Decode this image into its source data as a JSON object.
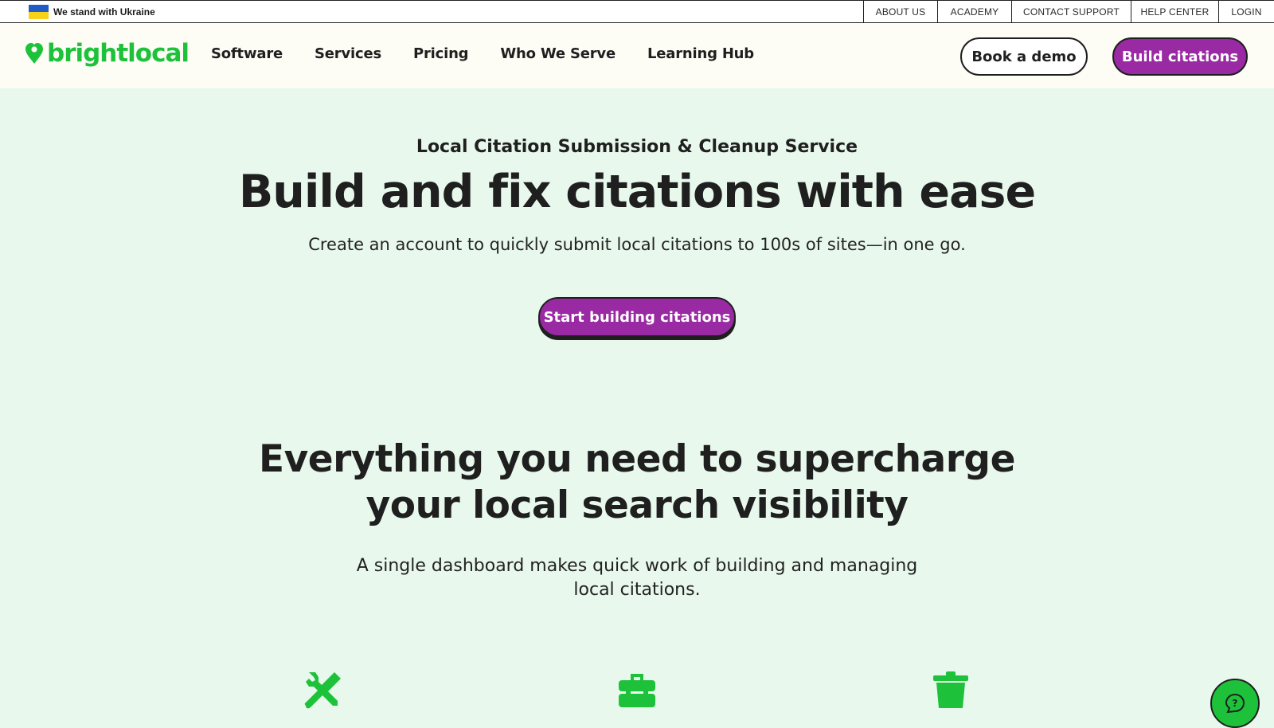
{
  "topbar": {
    "ukraine_text": "We stand with Ukraine",
    "links": [
      "ABOUT US",
      "ACADEMY",
      "CONTACT SUPPORT",
      "HELP CENTER",
      "LOGIN"
    ],
    "flag_colors": {
      "top": "#1f5cc4",
      "bottom": "#f6d21b"
    }
  },
  "header": {
    "logo_text": "brightlocal",
    "nav": [
      "Software",
      "Services",
      "Pricing",
      "Who We Serve",
      "Learning Hub"
    ],
    "demo_label": "Book a demo",
    "build_label": "Build citations"
  },
  "hero": {
    "eyebrow": "Local Citation Submission & Cleanup Service",
    "title": "Build and fix citations with ease",
    "subtitle": "Create an account to quickly submit local citations to 100s of sites—in one go.",
    "cta_label": "Start building citations"
  },
  "features": {
    "title_line1": "Everything you need to supercharge",
    "title_line2": "your local search visibility",
    "subtitle_line1": "A single dashboard makes quick work of building and managing",
    "subtitle_line2": "local citations.",
    "icons": [
      "tools-icon",
      "toolbox-icon",
      "trash-icon"
    ]
  },
  "colors": {
    "brand_green": "#1dc23a",
    "brand_purple": "#9a2aa3",
    "page_bg": "#e8f8ec",
    "header_bg": "#fdfdf6"
  },
  "help": {
    "icon": "help-chat-icon"
  }
}
